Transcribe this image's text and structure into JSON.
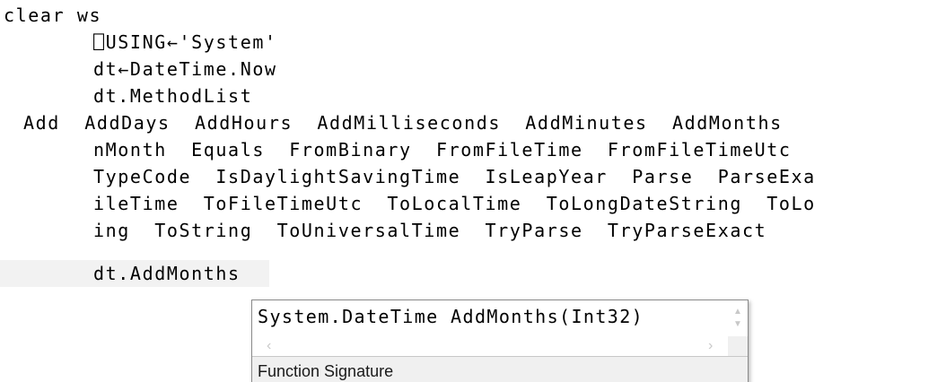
{
  "session": {
    "lines": [
      "clear ws",
      "⎕USING←'System'",
      "dt←DateTime.Now",
      "dt.MethodList",
      "Add  AddDays  AddHours  AddMilliseconds  AddMinutes  AddMonths",
      "nMonth  Equals  FromBinary  FromFileTime  FromFileTimeUtc",
      "TypeCode  IsDaylightSavingTime  IsLeapYear  Parse  ParseExa",
      "ileTime  ToFileTimeUtc  ToLocalTime  ToLongDateString  ToLo",
      "ing  ToString  ToUniversalTime  TryParse  TryParseExact",
      "dt.AddMonths"
    ]
  },
  "popup": {
    "signature": "System.DateTime AddMonths(Int32)",
    "status": "Function Signature",
    "scroll_up_icon": "chevron-up",
    "scroll_down_icon": "chevron-down",
    "scroll_left_icon": "chevron-left",
    "scroll_right_icon": "chevron-right"
  },
  "colors": {
    "current_line_bg": "#f2f2f2",
    "popup_border": "#8a8a8a",
    "status_bg": "#f0f0f0"
  }
}
